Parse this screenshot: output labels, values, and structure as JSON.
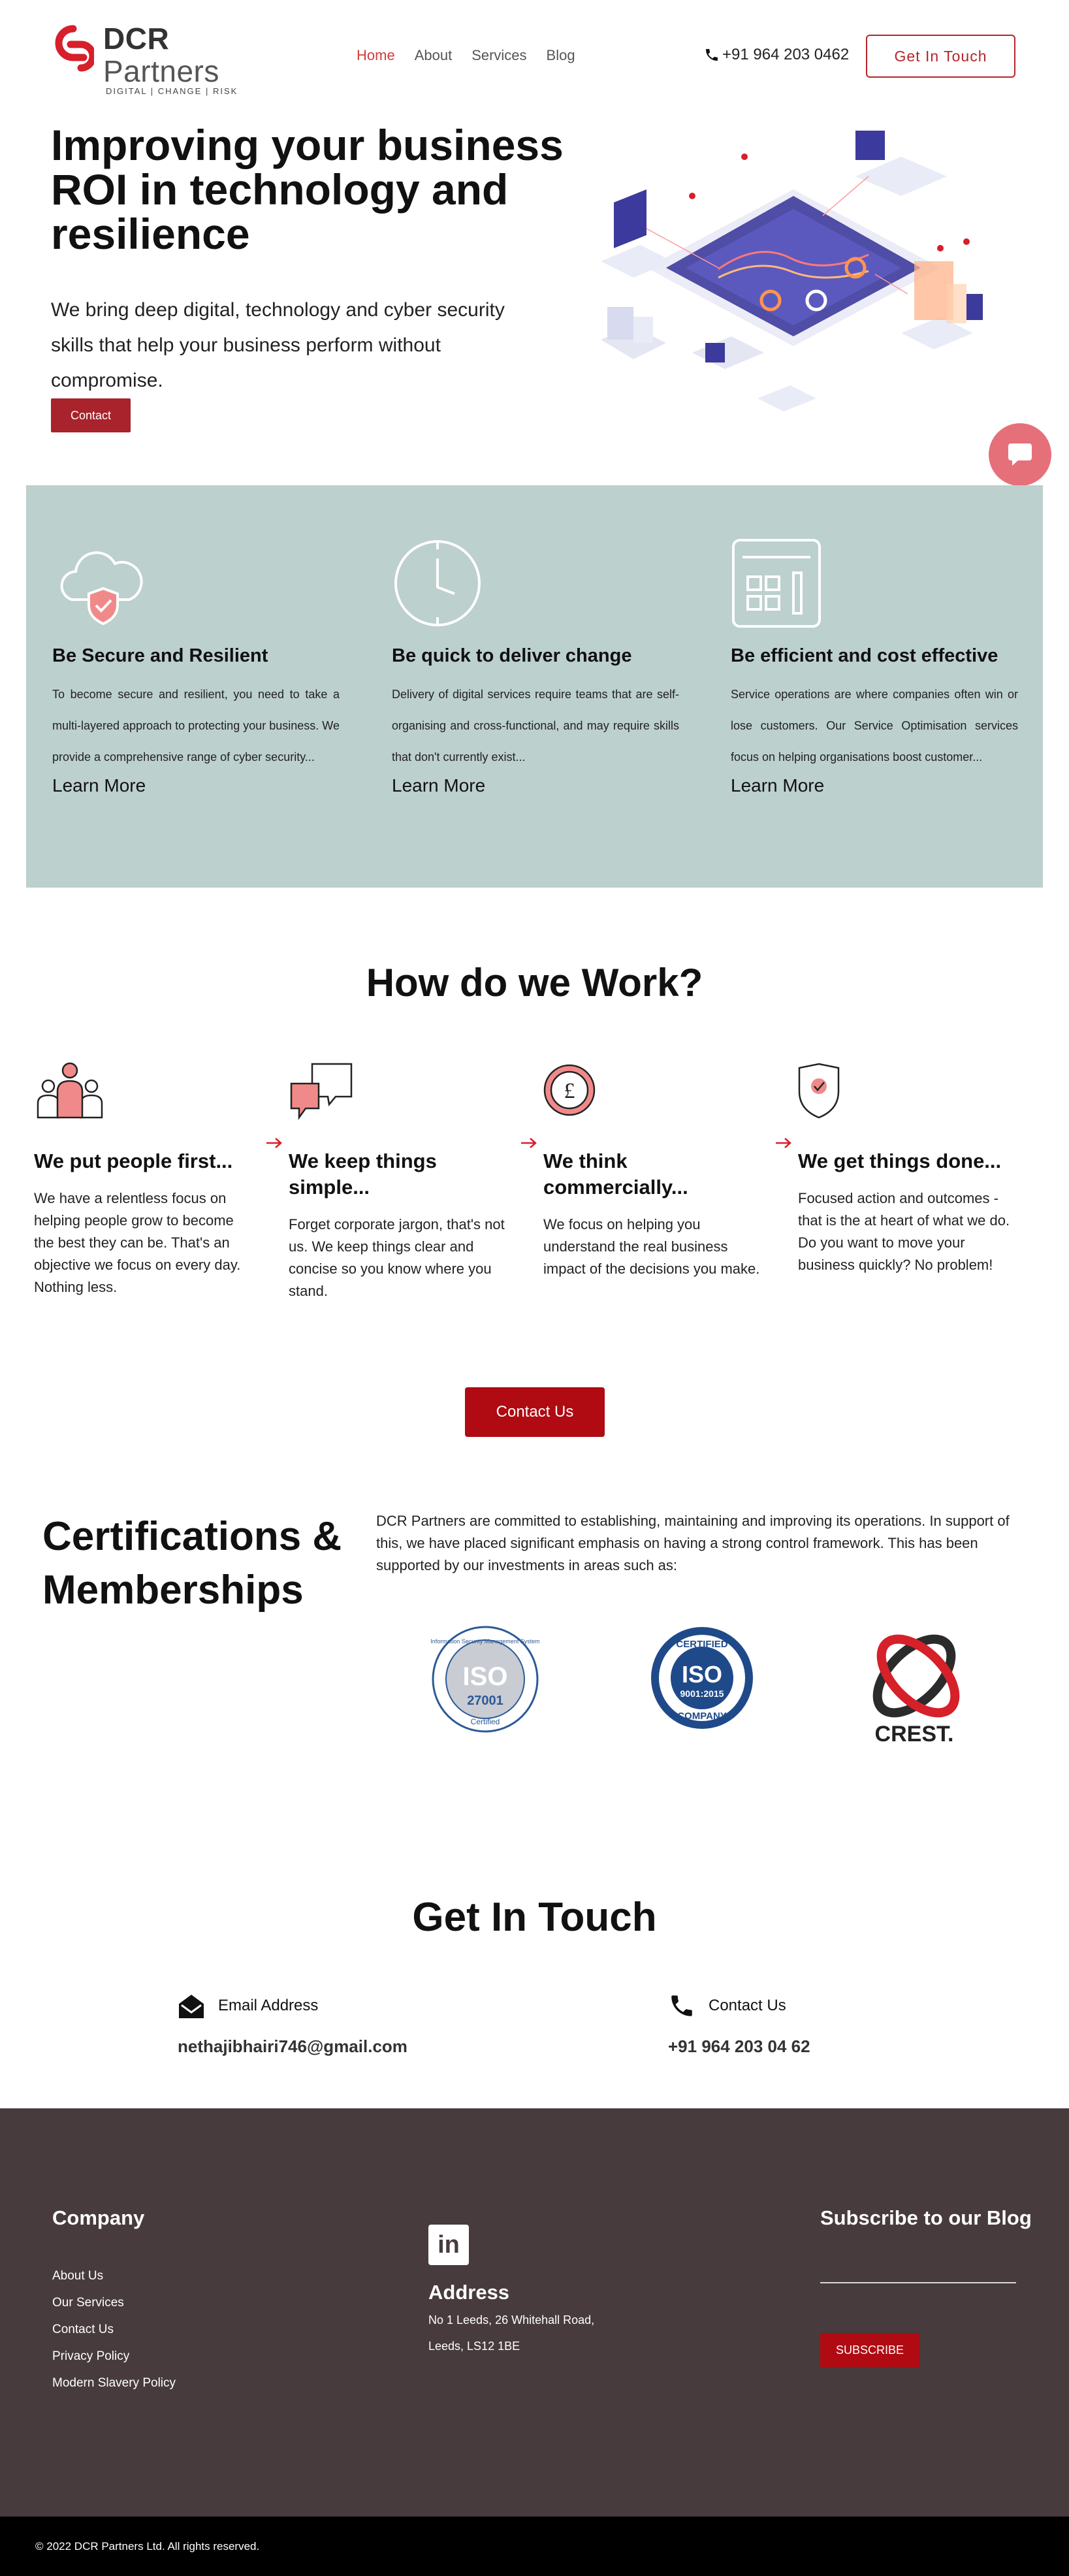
{
  "header": {
    "logo_dcr": "DCR",
    "logo_partners": "Partners",
    "logo_tagline": "DIGITAL | CHANGE | RISK",
    "nav": [
      "Home",
      "About",
      "Services",
      "Blog"
    ],
    "phone": "+91 964 203 0462",
    "cta": "Get  In  Touch"
  },
  "hero": {
    "title": "Improving your business ROI in technology and resilience",
    "subtitle": "We bring deep digital, technology and cyber security skills that help your business perform without compromise.",
    "button": "Contact"
  },
  "features": [
    {
      "title": "Be Secure and Resilient",
      "desc": "To become secure and resilient, you need to take a multi-layered approach to protecting your business. We provide a comprehensive range of cyber security...",
      "link": "Learn More",
      "icon": "cloud-shield-icon"
    },
    {
      "title": "Be quick to deliver change",
      "desc": "Delivery of digital services require teams that are self-organising and cross-functional, and may require skills that don't currently exist...",
      "link": "Learn More",
      "icon": "clock-icon"
    },
    {
      "title": "Be efficient and cost effective",
      "desc": "Service operations are where companies often win or lose customers. Our Service Optimisation services focus on helping organisations boost customer...",
      "link": "Learn More",
      "icon": "dashboard-icon"
    }
  ],
  "how": {
    "title": "How do we Work?",
    "items": [
      {
        "title": "We put people first...",
        "desc": "We have a relentless focus on helping people grow to become the best they can be. That's an objective we focus on every day. Nothing less.",
        "icon": "people-icon"
      },
      {
        "title": "We keep things simple...",
        "desc": "Forget corporate jargon, that's not us. We keep things clear and concise so you know where you stand.",
        "icon": "speech-bubbles-icon"
      },
      {
        "title": "We think commercially...",
        "desc": "We focus on helping you understand the real business impact of the decisions you make.",
        "icon": "pound-coin-icon"
      },
      {
        "title": "We get things done...",
        "desc": "Focused action and outcomes - that is the at heart of what we do. Do you want to move your business quickly? No problem!",
        "icon": "shield-check-icon"
      }
    ],
    "button": "Contact Us"
  },
  "certs": {
    "title": "Certifications & Memberships",
    "desc": "DCR Partners are committed to establishing, maintaining and improving its operations. In support of this, we have placed significant emphasis on having a strong control framework. This has been supported by our investments in areas such as:",
    "iso27001": {
      "ring": "Information Security Management System",
      "top": "ISO",
      "num": "27001",
      "bottom": "Certified"
    },
    "iso9001": {
      "top": "CERTIFIED",
      "iso": "ISO",
      "num": "9001:2015",
      "bottom": "COMPANY"
    },
    "crest": "CREST."
  },
  "contact": {
    "title": "Get In Touch",
    "email_label": "Email  Address",
    "email": "nethajibhairi746@gmail.com",
    "phone_label": "Contact  Us",
    "phone": "+91  964  203  04  62"
  },
  "footer": {
    "company_heading": "Company",
    "links": [
      "About Us",
      "Our Services",
      "Contact Us",
      "Privacy Policy",
      "Modern Slavery Policy"
    ],
    "linkedin": "in",
    "address_heading": "Address",
    "address": "No 1 Leeds, 26 Whitehall Road, Leeds, LS12 1BE",
    "subscribe_heading": "Subscribe to our Blog",
    "subscribe_button": "SUBSCRIBE",
    "copyright": "© 2022 DCR Partners Ltd. All rights reserved."
  },
  "colors": {
    "accent": "#b00a12",
    "teal_panel": "#bcd0cd",
    "footer": "#473b3d"
  }
}
